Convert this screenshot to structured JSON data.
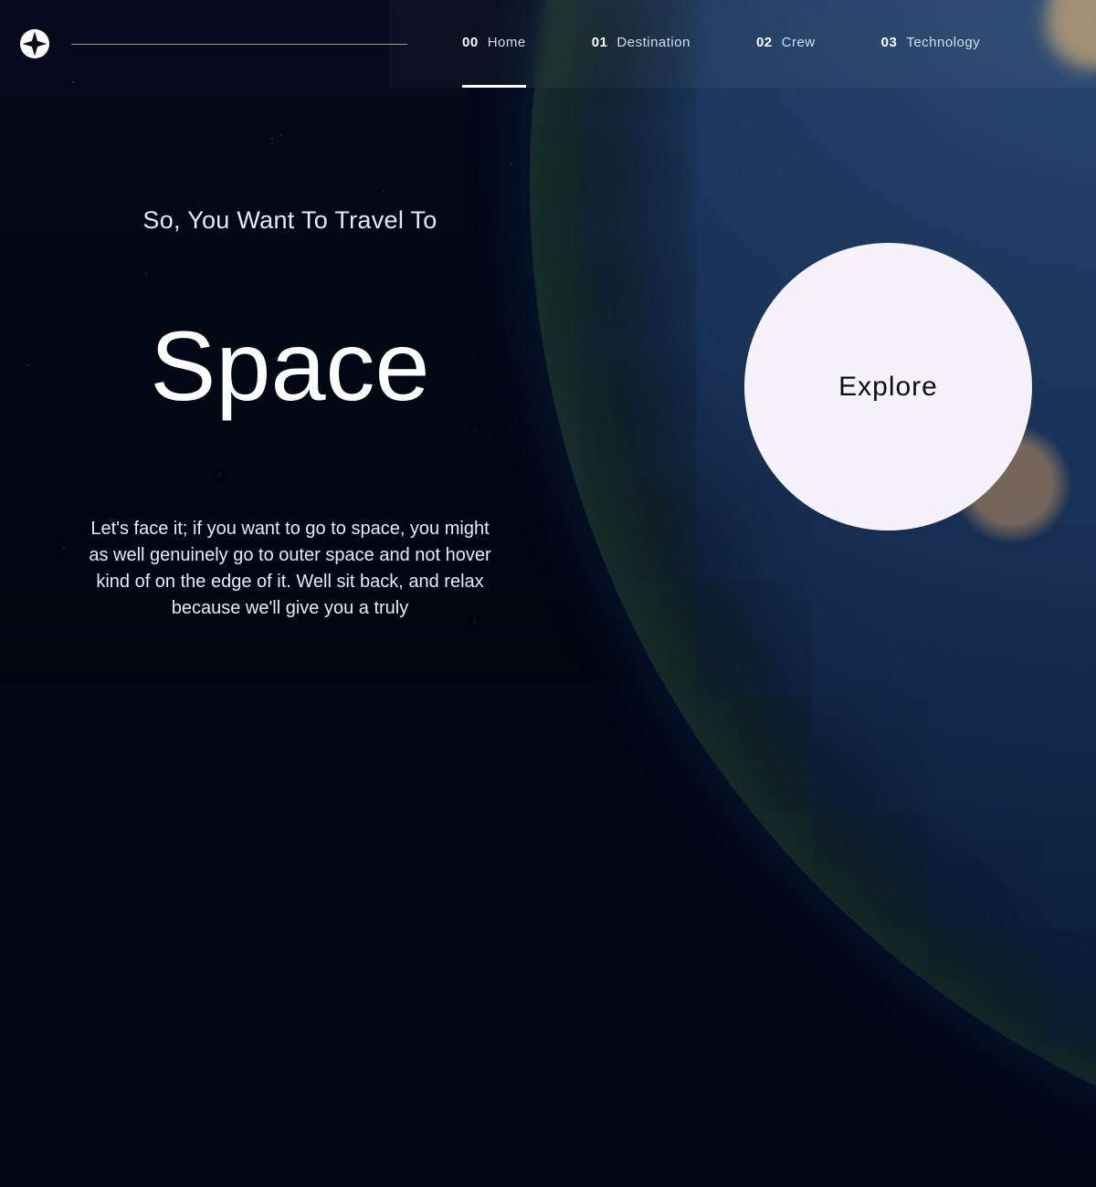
{
  "nav": {
    "items": [
      {
        "num": "00",
        "label": "Home",
        "active": true
      },
      {
        "num": "01",
        "label": "Destination",
        "active": false
      },
      {
        "num": "02",
        "label": "Crew",
        "active": false
      },
      {
        "num": "03",
        "label": "Technology",
        "active": false
      }
    ]
  },
  "hero": {
    "eyebrow": "So, You Want To Travel To",
    "title": "Space",
    "body": "Let's face it; if you want to go to space, you might as well genuinely go to outer space and not hover kind of on the edge of it. Well sit back, and relax because we'll give you a truly",
    "cta": "Explore"
  }
}
